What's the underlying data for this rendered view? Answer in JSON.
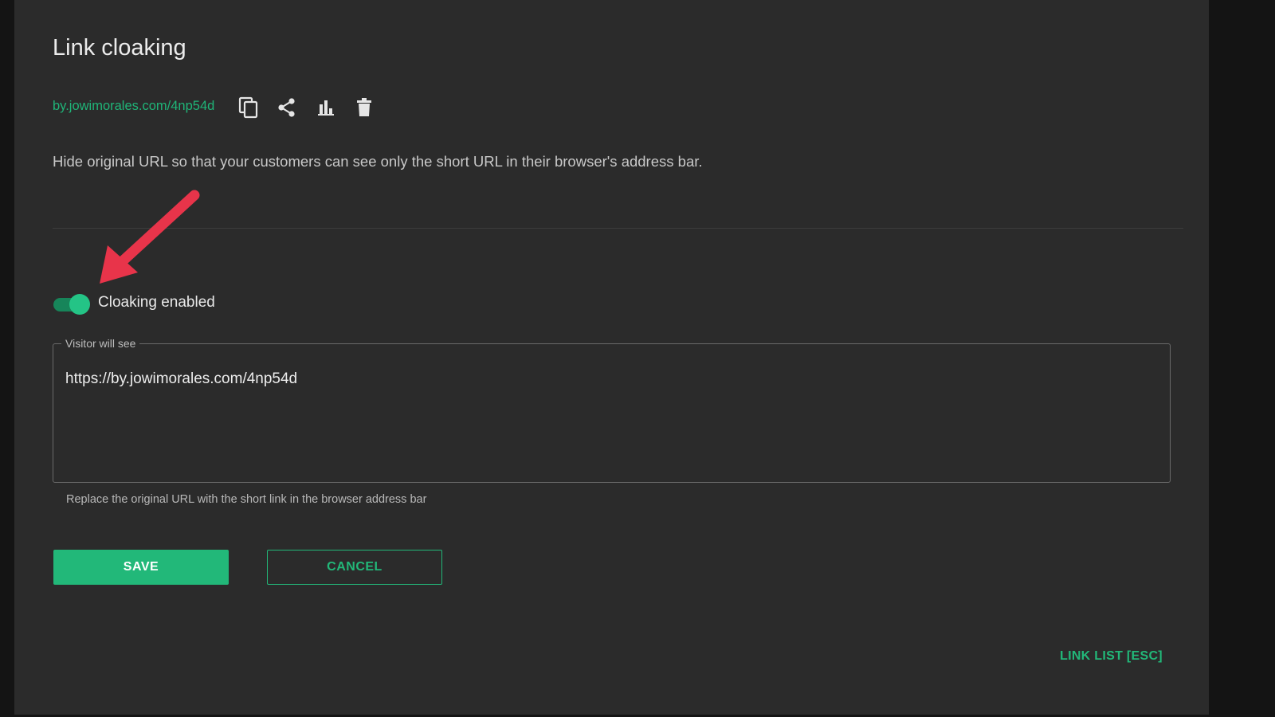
{
  "page": {
    "title": "Link cloaking",
    "short_link": "by.jowimorales.com/4np54d",
    "description": "Hide original URL so that your customers can see only the short URL in their browser's address bar."
  },
  "toolbar": {
    "icons": [
      "copy-icon",
      "share-icon",
      "bar-chart-icon",
      "trash-icon"
    ]
  },
  "toggle": {
    "label": "Cloaking enabled",
    "enabled": true
  },
  "visitor_field": {
    "legend": "Visitor will see",
    "value": "https://by.jowimorales.com/4np54d",
    "helper": "Replace the original URL with the short link in the browser address bar"
  },
  "actions": {
    "save_label": "SAVE",
    "cancel_label": "CANCEL",
    "link_list_label": "LINK LIST [ESC]"
  },
  "colors": {
    "accent": "#22b879",
    "panel": "#2b2b2b",
    "annotation_arrow": "#e8344a"
  }
}
